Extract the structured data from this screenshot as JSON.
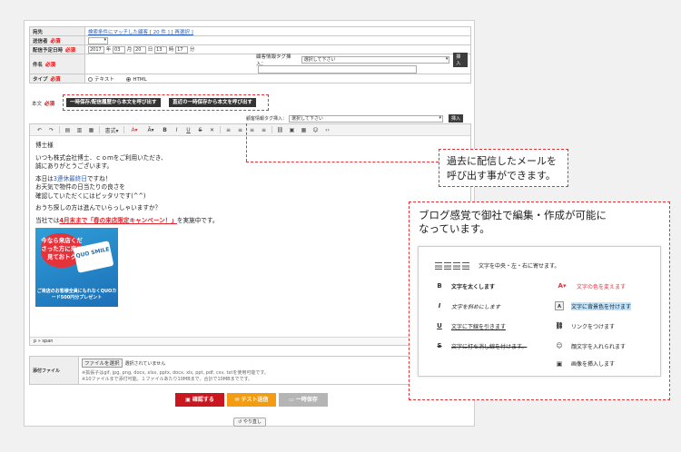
{
  "form": {
    "recipient_label": "宛先",
    "recipient_link": "検索条件にマッチした顧客 [ 20 件 ] [ 再選択 ]",
    "sender_label": "送信者",
    "required": "必須",
    "schedule_label": "配信予定日時",
    "schedule": {
      "year": "2017",
      "year_unit": "年",
      "month": "03",
      "month_unit": "月",
      "day": "20",
      "day_unit": "日",
      "hour": "13",
      "hour_unit": "時",
      "minute": "17",
      "minute_unit": "分"
    },
    "subject_label": "件名",
    "tag_insert_label": "顧客情報タグ挿入：",
    "tag_select_placeholder": "選択して下さい",
    "insert_button": "挿入",
    "type_label": "タイプ",
    "type_options": [
      "テキスト",
      "HTML"
    ],
    "body_label": "本文"
  },
  "template_buttons": [
    "一時保存/配信履歴から本文を呼び出す",
    "直近の一時保存から本文を呼び出す"
  ],
  "toolbar": {
    "style_label": "書式"
  },
  "editor_content": {
    "line1": "博士様",
    "line2": "いつも株式会社博士．ｃｏｍをご利用いただき、",
    "line3": "誠にありがとうございます。",
    "line4_prefix": "本日は",
    "line4_blue": "3連休最終日",
    "line4_suffix": "ですね！",
    "line5": "お天気で物件の日当たりの良さを",
    "line6": "確認していただくにはピッタリです(^^)",
    "line7": "おうち探しの方は進んでいらっしゃいますか？",
    "line8_prefix": "当社では",
    "line8_red": "4月末まで「春の来店限定キャンペーン！」",
    "line8_suffix": "を実施中です。",
    "quo_burst": "今なら来店くださった方に来て見ておトク",
    "quo_card": "QUO SMILE",
    "quo_caption": "ご来店のお客様全員にもれなくQUOカード500円分プレゼント"
  },
  "statusbar": "p » span",
  "attach": {
    "label": "添付ファイル",
    "file_button": "ファイルを選択",
    "file_status": "選択されていません",
    "note1": "※拡張子はgif, jpg, png, docx, xlsx, pptx, docx, xls, ppt, pdf, csv, txtを使用可能です。",
    "note2": "※10ファイルまで添付可能。１ファイルあたり10MBまで、合計で10MBまでです。"
  },
  "actions": {
    "confirm": "確認する",
    "test": "テスト送信",
    "draft": "一時保存",
    "reset": "やり直し"
  },
  "colors": {
    "confirm": "#c9161f",
    "test": "#f39c12",
    "draft": "#b5b5b5",
    "accent_red": "#e5323b"
  },
  "callout1": {
    "text": "過去に配信したメールを呼び出す事ができます。"
  },
  "callout2": {
    "title": "ブログ感覚で御社で編集・作成が可能になっています。",
    "features_left": [
      "文字を中央・左・右に寄せます。",
      "文字を太くします",
      "文字を斜めにします",
      "文字に下線を引きます",
      "文字に打ち消し線を付けます。"
    ],
    "features_right": [
      "文字の色を変えます",
      "文字に背景色を付けます",
      "リンクをつけます",
      "顔文字を入れられます",
      "画像を挿入します"
    ]
  }
}
